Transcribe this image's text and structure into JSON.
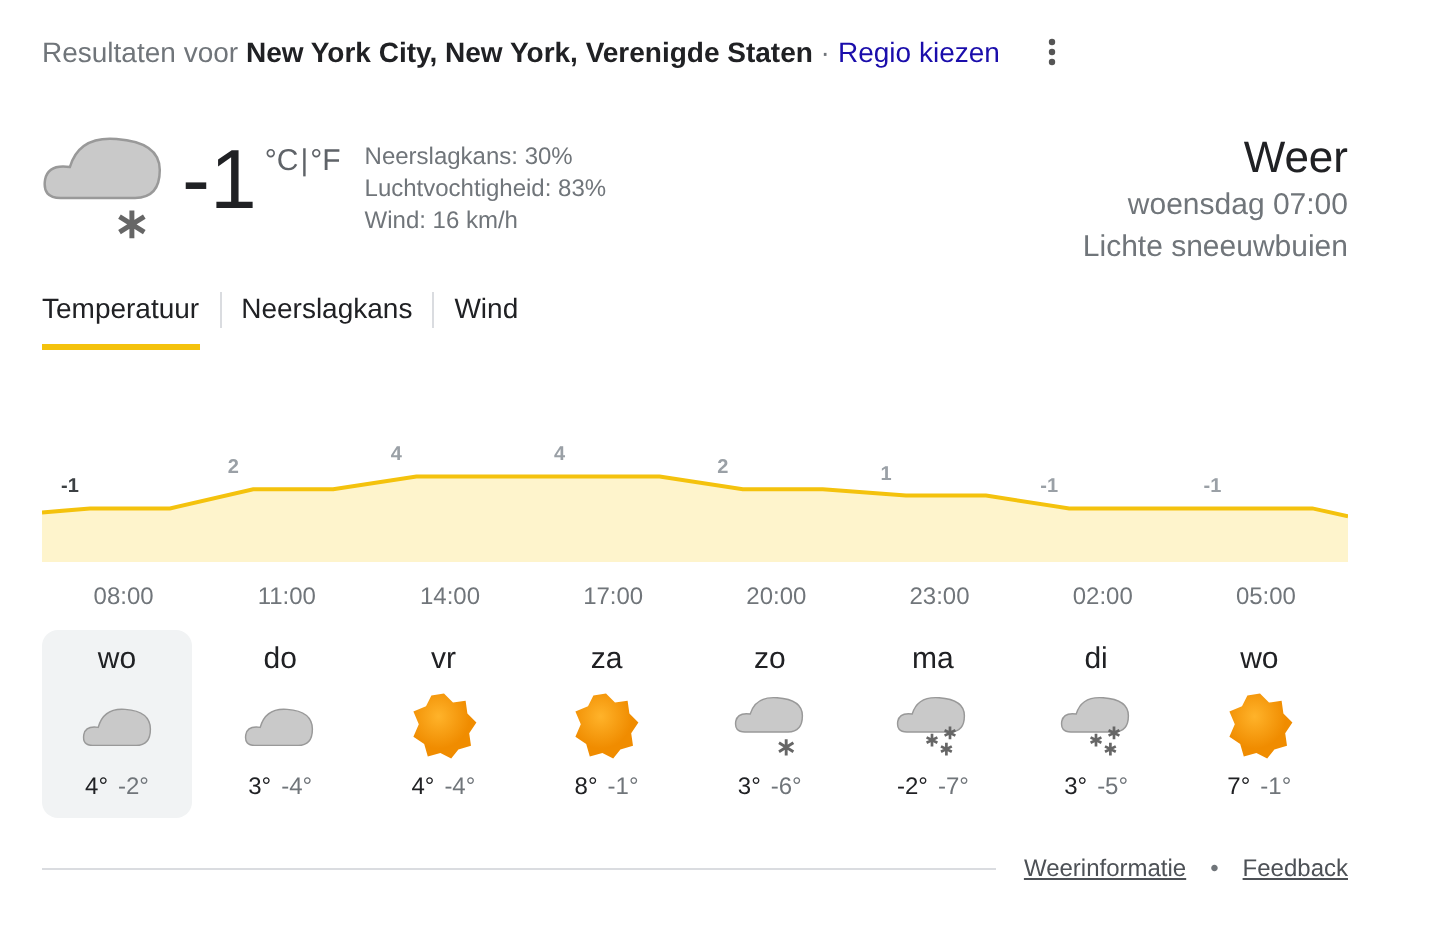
{
  "header": {
    "prefix": "Resultaten voor",
    "location": "New York City, New York, Verenigde Staten",
    "separator": "·",
    "link": "Regio kiezen"
  },
  "current": {
    "kind": "snow-light",
    "temperature": "-1",
    "unit_c": "°C",
    "unit_sep": "|",
    "unit_f": "°F",
    "details": [
      "Neerslagkans: 30%",
      "Luchtvochtigheid: 83%",
      "Wind: 16 km/h"
    ]
  },
  "summary": {
    "title": "Weer",
    "time": "woensdag 07:00",
    "condition": "Lichte sneeuwbuien"
  },
  "tabs": [
    {
      "label": "Temperatuur",
      "selected": true
    },
    {
      "label": "Neerslagkans",
      "selected": false
    },
    {
      "label": "Wind",
      "selected": false
    }
  ],
  "hourly": [
    {
      "time": "08:00",
      "temperature": "-1"
    },
    {
      "time": "11:00",
      "temperature": "2"
    },
    {
      "time": "14:00",
      "temperature": "4"
    },
    {
      "time": "17:00",
      "temperature": "4"
    },
    {
      "time": "20:00",
      "temperature": "2"
    },
    {
      "time": "23:00",
      "temperature": "1"
    },
    {
      "time": "02:00",
      "temperature": "-1"
    },
    {
      "time": "05:00",
      "temperature": "-1"
    }
  ],
  "days": [
    {
      "day": "wo",
      "kind": "cloud",
      "high": "4°",
      "low": "-2°",
      "selected": true
    },
    {
      "day": "do",
      "kind": "cloud",
      "high": "3°",
      "low": "-4°",
      "selected": false
    },
    {
      "day": "vr",
      "kind": "sun",
      "high": "4°",
      "low": "-4°",
      "selected": false
    },
    {
      "day": "za",
      "kind": "sun",
      "high": "8°",
      "low": "-1°",
      "selected": false
    },
    {
      "day": "zo",
      "kind": "snow-light",
      "high": "3°",
      "low": "-6°",
      "selected": false
    },
    {
      "day": "ma",
      "kind": "snow",
      "high": "-2°",
      "low": "-7°",
      "selected": false
    },
    {
      "day": "di",
      "kind": "snow",
      "high": "3°",
      "low": "-5°",
      "selected": false
    },
    {
      "day": "wo",
      "kind": "sun",
      "high": "7°",
      "low": "-1°",
      "selected": false
    }
  ],
  "footer": {
    "links": [
      "Weerinformatie",
      "Feedback"
    ],
    "separator": "•"
  }
}
